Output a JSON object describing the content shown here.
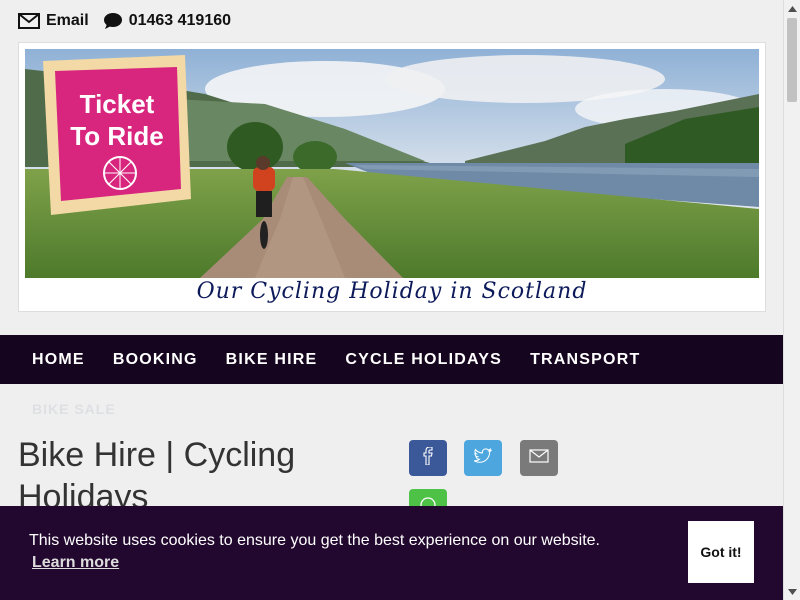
{
  "contact": {
    "email_label": "Email",
    "phone": "01463 419160"
  },
  "hero": {
    "logo_line1": "Ticket",
    "logo_line2": "To Ride",
    "caption": "Our Cycling Holiday in Scotland"
  },
  "nav": {
    "items": [
      "HOME",
      "BOOKING",
      "BIKE HIRE",
      "CYCLE HOLIDAYS",
      "TRANSPORT"
    ],
    "overflow_item": "BIKE SALE"
  },
  "page": {
    "title": "Bike Hire | Cycling Holidays"
  },
  "share": {
    "icons": [
      "facebook-icon",
      "twitter-icon",
      "email-icon",
      "whatsapp-icon"
    ]
  },
  "cookie": {
    "message": "This website uses cookies to ensure you get the best experience on our website.",
    "learn_more": "Learn more",
    "accept": "Got it!"
  },
  "colors": {
    "nav_bg": "#16051f",
    "cookie_bg": "#22082e",
    "logo_pink": "#d8267f",
    "facebook": "#3b5998",
    "twitter": "#4da7de",
    "email": "#7a7a7a",
    "whatsapp": "#4dc247"
  }
}
